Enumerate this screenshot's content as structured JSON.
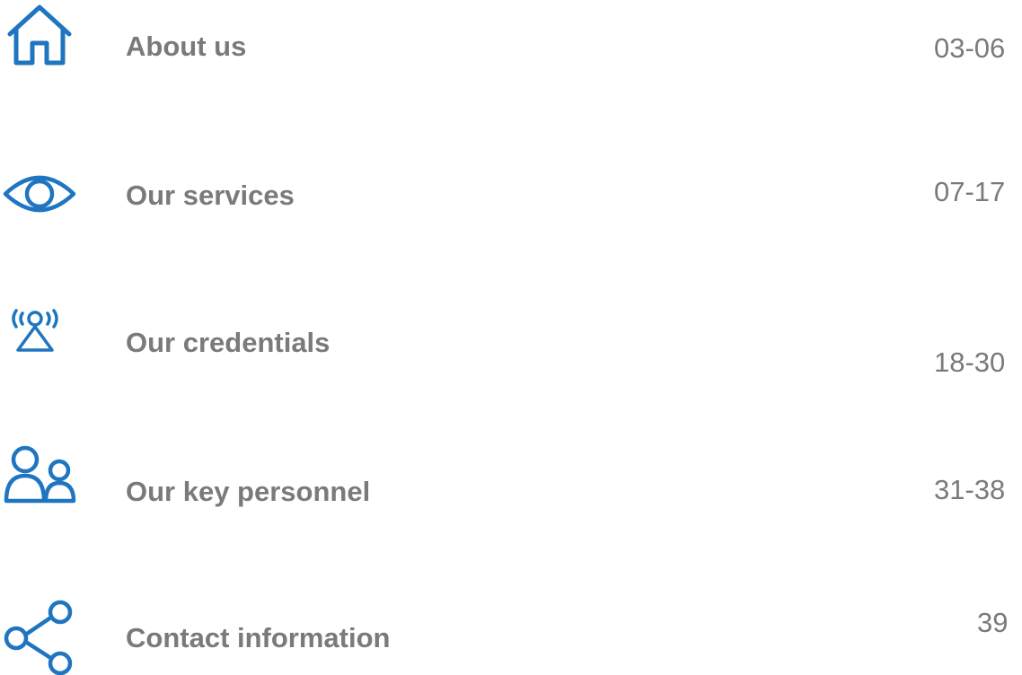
{
  "accent_color": "#1f75c0",
  "text_color": "#7a7a7a",
  "items": [
    {
      "label": "About us",
      "pages": "03-06",
      "icon": "home-icon"
    },
    {
      "label": "Our services",
      "pages": "07-17",
      "icon": "eye-icon"
    },
    {
      "label": "Our credentials",
      "pages": "18-30",
      "icon": "broadcast-tower-icon"
    },
    {
      "label": "Our key personnel",
      "pages": "31-38",
      "icon": "people-icon"
    },
    {
      "label": "Contact information",
      "pages": "39",
      "icon": "share-icon"
    }
  ]
}
